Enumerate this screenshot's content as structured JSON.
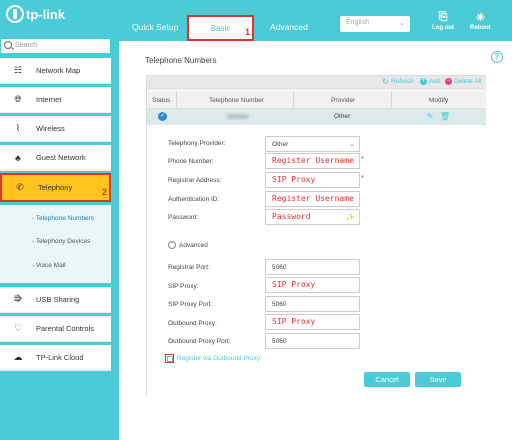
{
  "header": {
    "logo_text": "tp-link",
    "tabs": [
      {
        "label": "Quick Setup"
      },
      {
        "label": "Basic"
      },
      {
        "label": "Advanced"
      }
    ],
    "basic_marker": "1",
    "language": "English",
    "logout_label": "Log out",
    "reboot_label": "Reboot"
  },
  "sidebar": {
    "search_placeholder": "Search",
    "items": [
      {
        "label": "Network Map",
        "icon": "network-map-icon"
      },
      {
        "label": "Internet",
        "icon": "globe-icon"
      },
      {
        "label": "Wireless",
        "icon": "wifi-icon"
      },
      {
        "label": "Guest Network",
        "icon": "guest-network-icon"
      },
      {
        "label": "Telephony",
        "icon": "phone-icon"
      },
      {
        "label": "USB Sharing",
        "icon": "usb-icon"
      },
      {
        "label": "Parental Controls",
        "icon": "heart-icon"
      },
      {
        "label": "TP-Link Cloud",
        "icon": "cloud-icon"
      }
    ],
    "telephony_marker": "2",
    "sub_items": [
      {
        "label": "- Telephone Numbers"
      },
      {
        "label": "- Telephony Devices"
      },
      {
        "label": "- Voice Mail"
      }
    ]
  },
  "main": {
    "section_title": "Telephone Numbers",
    "tools": {
      "refresh": "Refresh",
      "add": "Add",
      "delete_all": "Delete All"
    },
    "table": {
      "headers": [
        "Status",
        "Telephone Number",
        "Provider",
        "Modify"
      ],
      "row": {
        "provider": "Other"
      }
    },
    "form": {
      "provider_label": "Telephony Provider:",
      "provider_value": "Other",
      "phone_label": "Phone Number:",
      "phone_value": "Register Username",
      "registrar_label": "Registrar Address:",
      "registrar_value": "SIP Proxy",
      "auth_label": "Authentication ID:",
      "auth_value": "Register Username",
      "password_label": "Password:",
      "password_value": "Password",
      "advanced_label": "Advanced",
      "registrar_port_label": "Registrar Port:",
      "registrar_port_value": "5060",
      "sip_proxy_label": "SIP Proxy:",
      "sip_proxy_value": "SIP Proxy",
      "sip_proxy_port_label": "SIP Proxy Port:",
      "sip_proxy_port_value": "5060",
      "outbound_proxy_label": "Outbound Proxy:",
      "outbound_proxy_value": "SIP Proxy",
      "outbound_port_label": "Outbound Proxy Port:",
      "outbound_port_value": "5060",
      "register_outbound_label": "Register via Outbound Proxy",
      "cancel_label": "Cancel",
      "save_label": "Save"
    }
  },
  "colors": {
    "accent": "#4acbd6",
    "highlight": "#ffc31e",
    "annotation": "#e52e2e"
  }
}
